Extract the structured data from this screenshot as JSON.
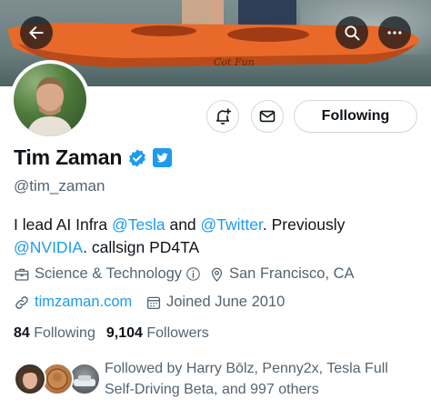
{
  "colors": {
    "accent": "#1d9bf0",
    "verified": "#1d9bf0",
    "text_primary": "#0f1419",
    "text_secondary": "#536471",
    "border": "#cfd9de"
  },
  "banner": {
    "kayak_text": "Cot Fun"
  },
  "top_bar": {
    "back_icon": "arrow-left-icon",
    "search_icon": "search-icon",
    "more_icon": "more-dots-icon"
  },
  "actions": {
    "notify_icon": "bell-plus-icon",
    "message_icon": "envelope-icon",
    "following_label": "Following"
  },
  "profile": {
    "name": "Tim Zaman",
    "handle": "@tim_zaman",
    "bio": {
      "t1": "I lead AI Infra ",
      "m1": "@Tesla",
      "t2": " and ",
      "m2": "@Twitter",
      "t3": ". Previously ",
      "m3": "@NVIDIA",
      "t4": ". callsign PD4TA"
    },
    "category": "Science & Technology",
    "location": "San Francisco, CA",
    "website": "timzaman.com",
    "joined": "Joined June 2010"
  },
  "stats": {
    "following_count": "84",
    "following_label": "Following",
    "followers_count": "9,104",
    "followers_label": "Followers"
  },
  "followed_by": "Followed by Harry Bōlz, Penny2x, Tesla Full Self-Driving Beta, and 997 others"
}
